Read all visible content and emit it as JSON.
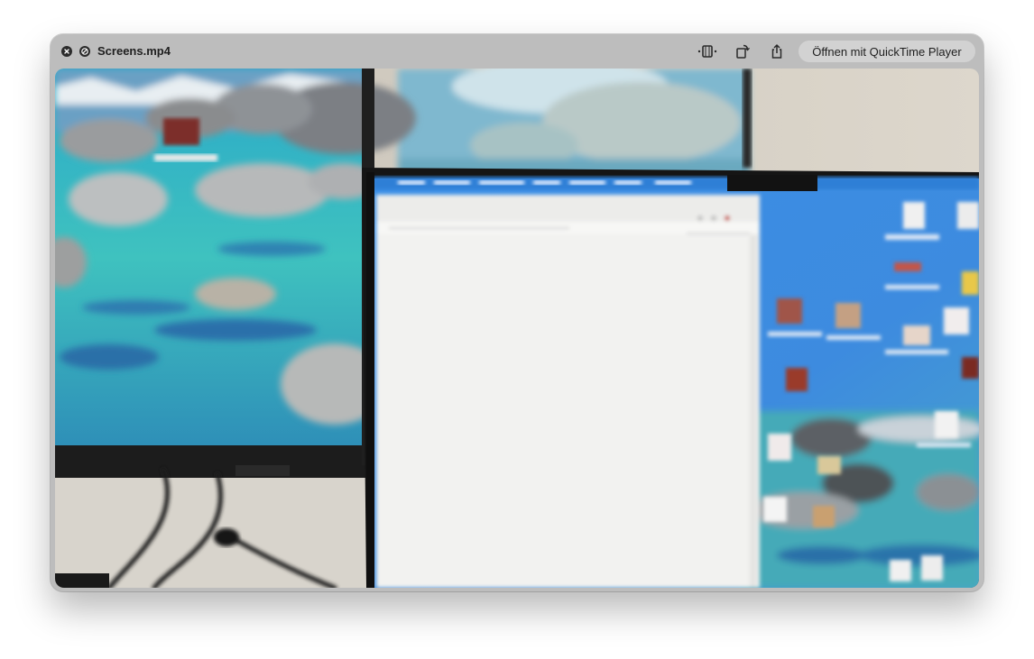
{
  "window": {
    "title": "Screens.mp4",
    "open_button_label": "Öffnen mit QuickTime Player"
  },
  "icons": {
    "close": "close-icon",
    "minimize": "minimize-icon",
    "trim": "trim-icon",
    "rotate": "rotate-icon",
    "share": "share-icon"
  },
  "colors": {
    "titlebar": "#bdbdbd",
    "button_bg": "#d2d2d2",
    "lake_turquoise": "#3cb8c0",
    "desktop_blue": "#3a8fe0"
  }
}
